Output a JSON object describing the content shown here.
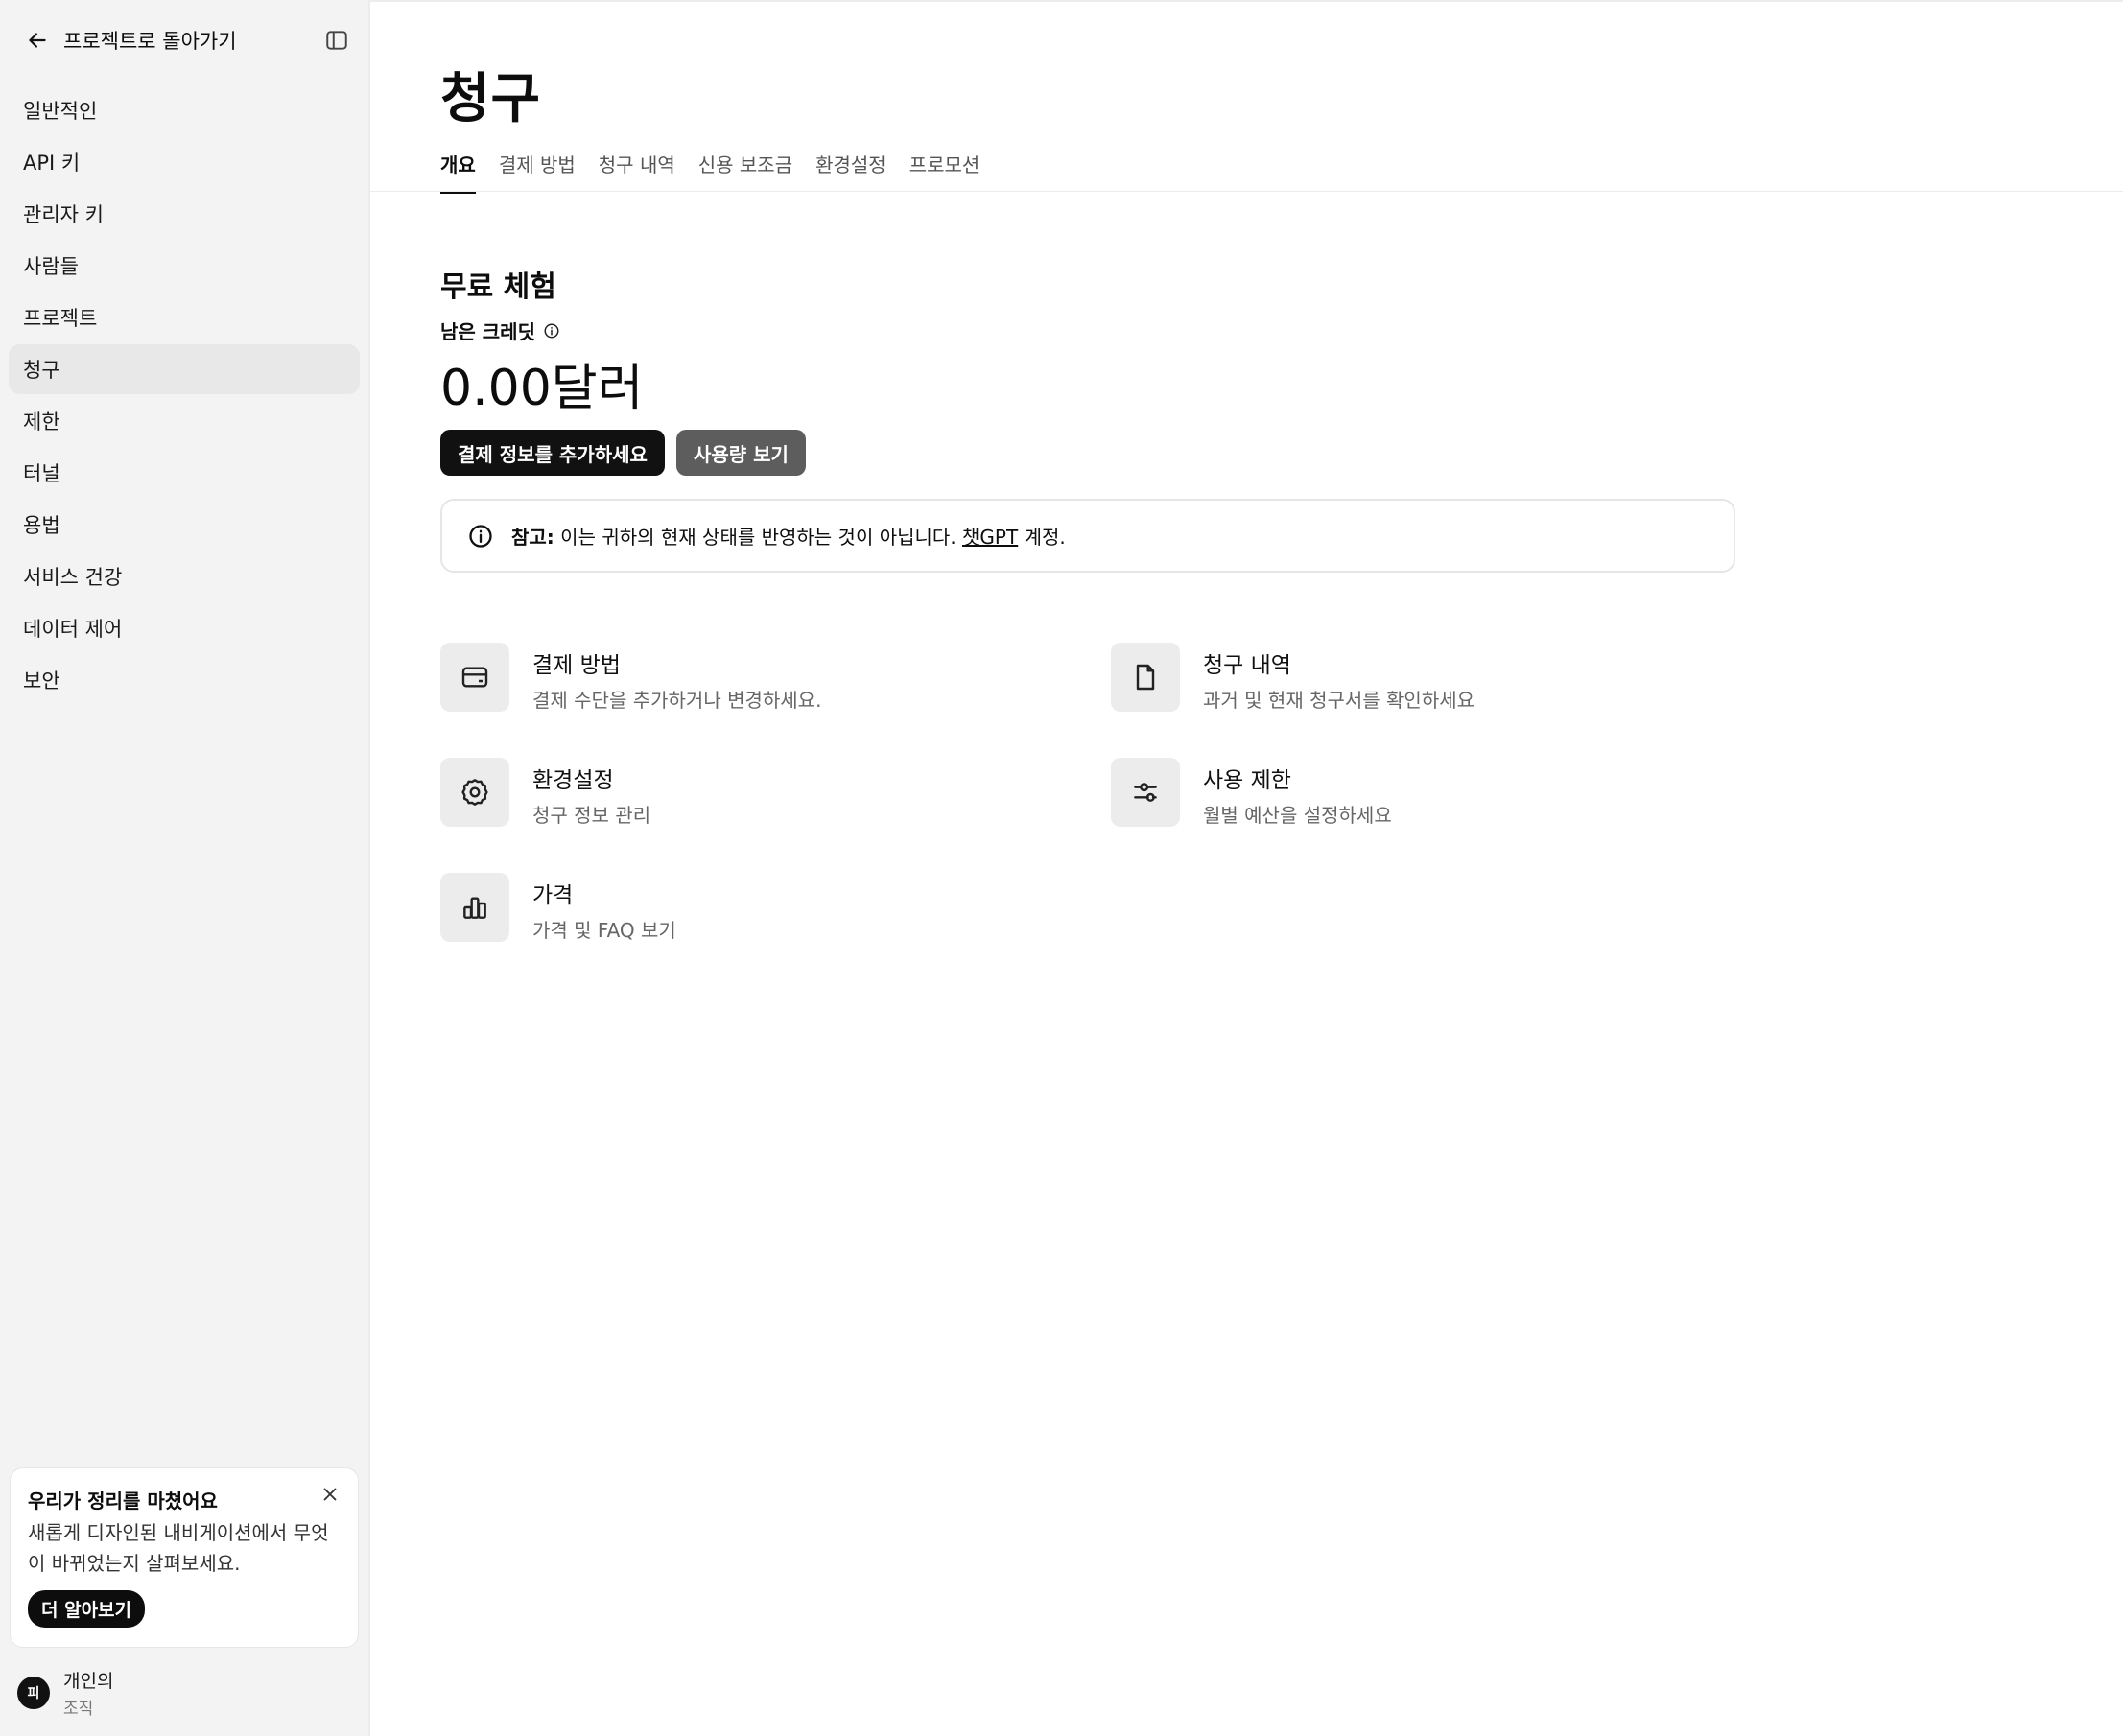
{
  "sidebar": {
    "back_label": "프로젝트로 돌아가기",
    "items": [
      {
        "label": "일반적인"
      },
      {
        "label": "API 키"
      },
      {
        "label": "관리자 키"
      },
      {
        "label": "사람들"
      },
      {
        "label": "프로젝트"
      },
      {
        "label": "청구",
        "active": true
      },
      {
        "label": "제한"
      },
      {
        "label": "터널"
      },
      {
        "label": "용법"
      },
      {
        "label": "서비스 건강"
      },
      {
        "label": "데이터 제어"
      },
      {
        "label": "보안"
      }
    ],
    "promo": {
      "title": "우리가 정리를 마쳤어요",
      "text": "새롭게 디자인된 내비게이션에서 무엇이 바뀌었는지 살펴보세요.",
      "button": "더 알아보기"
    },
    "org": {
      "avatar": "피",
      "name": "개인의",
      "type": "조직"
    }
  },
  "main": {
    "title": "청구",
    "tabs": [
      {
        "label": "개요",
        "active": true
      },
      {
        "label": "결제 방법"
      },
      {
        "label": "청구 내역"
      },
      {
        "label": "신용 보조금"
      },
      {
        "label": "환경설정"
      },
      {
        "label": "프로모션"
      }
    ],
    "section_title": "무료 체험",
    "credit_label": "남은 크레딧",
    "credit_amount": "0.00달러",
    "add_payment_button": "결제 정보를 추가하세요",
    "view_usage_button": "사용량 보기",
    "note": {
      "bold": "참고:",
      "text": " 이는 귀하의 현재 상태를 반영하는 것이 아닙니다. ",
      "link": "챗GPT",
      "suffix": " 계정."
    },
    "cards": [
      {
        "icon": "credit-card-icon",
        "title": "결제 방법",
        "desc": "결제 수단을 추가하거나 변경하세요."
      },
      {
        "icon": "document-icon",
        "title": "청구 내역",
        "desc": "과거 및 현재 청구서를 확인하세요"
      },
      {
        "icon": "gear-icon",
        "title": "환경설정",
        "desc": "청구 정보 관리"
      },
      {
        "icon": "sliders-icon",
        "title": "사용 제한",
        "desc": "월별 예산을 설정하세요"
      },
      {
        "icon": "bar-chart-icon",
        "title": "가격",
        "desc": "가격 및 FAQ 보기"
      }
    ]
  }
}
